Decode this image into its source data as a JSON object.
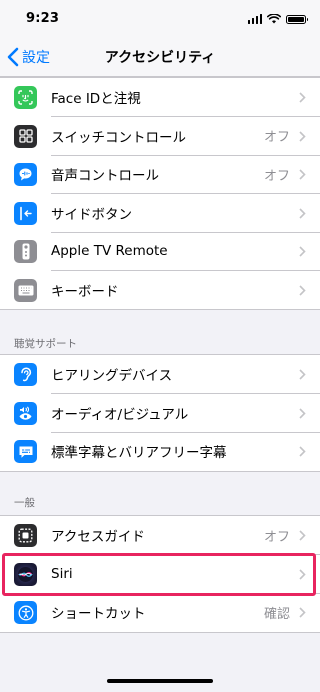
{
  "status_bar": {
    "time": "9:23"
  },
  "nav": {
    "back_label": "設定",
    "title": "アクセシビリティ"
  },
  "group_top": [
    {
      "label": "Face IDと注視",
      "value": "",
      "icon": "face-id-icon",
      "color": "#34c759"
    },
    {
      "label": "スイッチコントロール",
      "value": "オフ",
      "icon": "switch-control-icon",
      "color": "#2c2c2e"
    },
    {
      "label": "音声コントロール",
      "value": "オフ",
      "icon": "voice-control-icon",
      "color": "#0a84ff"
    },
    {
      "label": "サイドボタン",
      "value": "",
      "icon": "side-button-icon",
      "color": "#0a84ff"
    },
    {
      "label": "Apple TV Remote",
      "value": "",
      "icon": "tv-remote-icon",
      "color": "#8e8e93"
    },
    {
      "label": "キーボード",
      "value": "",
      "icon": "keyboard-icon",
      "color": "#8e8e93"
    }
  ],
  "hearing": {
    "header": "聴覚サポート",
    "items": [
      {
        "label": "ヒアリングデバイス",
        "value": "",
        "icon": "hearing-ear-icon",
        "color": "#0a84ff"
      },
      {
        "label": "オーディオ/ビジュアル",
        "value": "",
        "icon": "audio-visual-icon",
        "color": "#0a84ff"
      },
      {
        "label": "標準字幕とバリアフリー字幕",
        "value": "",
        "icon": "subtitles-icon",
        "color": "#0a84ff"
      }
    ]
  },
  "general": {
    "header": "一般",
    "items": [
      {
        "label": "アクセスガイド",
        "value": "オフ",
        "icon": "guided-access-icon",
        "color": "#2c2c2e"
      },
      {
        "label": "Siri",
        "value": "",
        "icon": "siri-icon",
        "color": "#1c1c3a"
      },
      {
        "label": "ショートカット",
        "value": "確認",
        "icon": "accessibility-shortcut-icon",
        "color": "#0a84ff"
      }
    ]
  },
  "highlight_color": "#e8245f"
}
